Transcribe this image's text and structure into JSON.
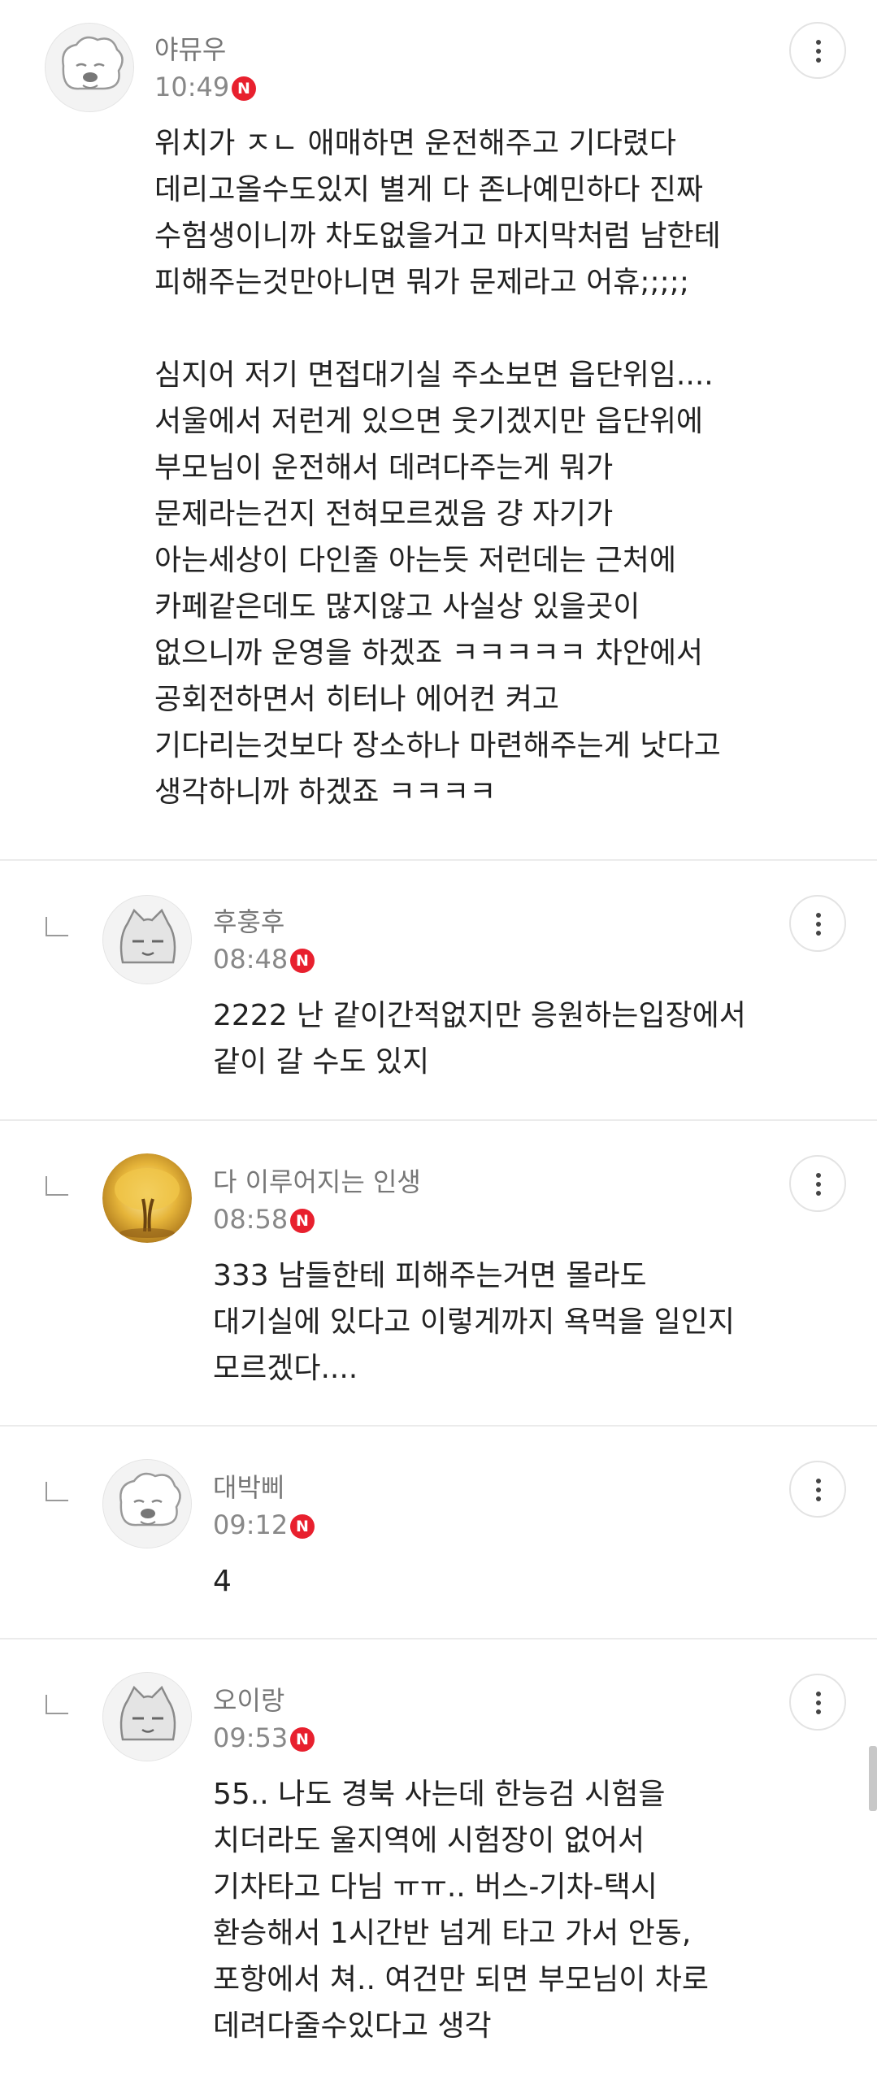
{
  "comments": [
    {
      "nickname": "야뮤우",
      "time": "10:49",
      "badge": "N",
      "avatar_icon": "dog-face-icon",
      "text": "위치가 ㅈㄴ 애매하면 운전해주고 기다렸다\n데리고올수도있지 별게 다 존나예민하다 진짜\n수험생이니까 차도없을거고 마지막처럼 남한테\n피해주는것만아니면 뭐가 문제라고 어휴;;;;;\n\n심지어 저기 면접대기실 주소보면 읍단위임....\n서울에서 저런게 있으면 웃기겠지만 읍단위에\n부모님이 운전해서 데려다주는게 뭐가\n문제라는건지 전혀모르겠음 걍 자기가\n아는세상이 다인줄 아는듯 저런데는 근처에\n카페같은데도 많지않고 사실상 있을곳이\n없으니까 운영을 하겠죠 ㅋㅋㅋㅋㅋ 차안에서\n공회전하면서 히터나 에어컨 켜고\n기다리는것보다 장소하나 마련해주는게 낫다고\n생각하니까 하겠죠 ㅋㅋㅋㅋ"
    },
    {
      "nickname": "후훙후",
      "time": "08:48",
      "badge": "N",
      "avatar_icon": "cat-face-icon",
      "text": "2222 난 같이간적없지만 응원하는입장에서\n같이 갈 수도 있지"
    },
    {
      "nickname": "다 이루어지는 인생",
      "time": "08:58",
      "badge": "N",
      "avatar_icon": "golden-tree-icon",
      "text": "333 남들한테 피해주는거면 몰라도\n대기실에 있다고 이렇게까지 욕먹을 일인지\n모르겠다...."
    },
    {
      "nickname": "대박삐",
      "time": "09:12",
      "badge": "N",
      "avatar_icon": "dog-face-icon",
      "text": "4"
    },
    {
      "nickname": "오이랑",
      "time": "09:53",
      "badge": "N",
      "avatar_icon": "cat-face-icon",
      "text": "55.. 나도 경북 사는데 한능검 시험을\n치더라도 울지역에 시험장이 없어서\n기차타고 다님 ㅠㅠ.. 버스-기차-택시\n환승해서 1시간반 넘게 타고 가서 안동,\n포항에서 쳐.. 여건만 되면 부모님이 차로\n데려다줄수있다고 생각"
    }
  ],
  "colors": {
    "badge": "#e8202e",
    "divider": "#ebebeb",
    "nickname": "#777777"
  }
}
